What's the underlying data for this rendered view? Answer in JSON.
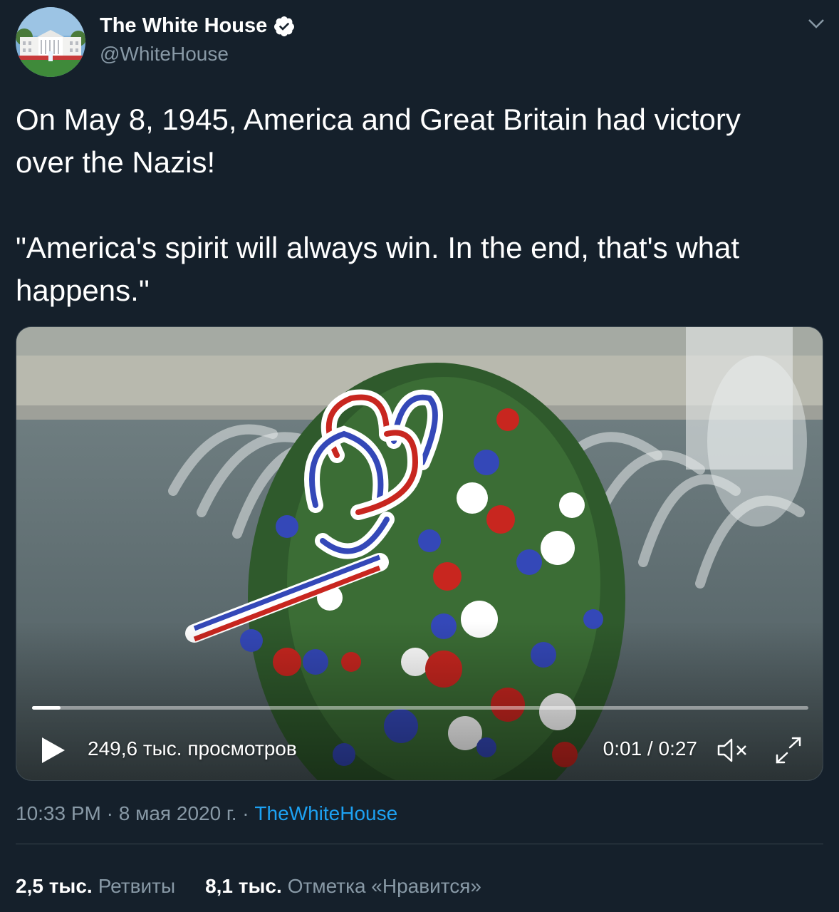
{
  "author": {
    "name": "The White House",
    "handle": "@WhiteHouse",
    "avatar_icon": "white-house-avatar",
    "verified_icon": "verified-badge-icon"
  },
  "tweet": {
    "paragraph1": "On May 8, 1945, America and Great Britain had victory over the Nazis!",
    "paragraph2": "\"America's spirit will always win. In the end, that's what happens.\""
  },
  "video": {
    "views": "249,6 тыс. просмотров",
    "time": "0:01 / 0:27",
    "progress": 0.037,
    "icons": [
      "play-icon",
      "mute-icon",
      "fullscreen-icon"
    ]
  },
  "meta": {
    "time": "10:33 PM",
    "date": "8 мая 2020 г.",
    "separator": "·",
    "source": "TheWhiteHouse"
  },
  "stats": {
    "retweets_count": "2,5 тыс.",
    "retweets_label": "Ретвиты",
    "likes_count": "8,1 тыс.",
    "likes_label": "Отметка «Нравится»"
  },
  "colors": {
    "background": "#15202b",
    "secondary_text": "#8899a6",
    "link": "#1da1f2",
    "verified": "#ffffff"
  }
}
